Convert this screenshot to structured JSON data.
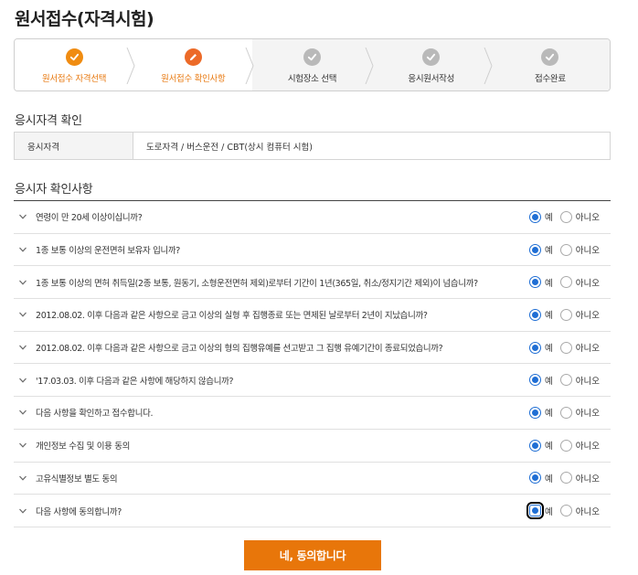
{
  "page": {
    "title": "원서접수(자격시험)"
  },
  "steps": [
    {
      "label": "원서접수 자격선택",
      "status": "done",
      "icon": "check-icon"
    },
    {
      "label": "원서접수 확인사항",
      "status": "current",
      "icon": "pencil-icon"
    },
    {
      "label": "시험장소 선택",
      "status": "todo",
      "icon": "check-icon"
    },
    {
      "label": "응시원서작성",
      "status": "todo",
      "icon": "check-icon"
    },
    {
      "label": "접수완료",
      "status": "todo",
      "icon": "check-icon"
    }
  ],
  "qualification": {
    "section_title": "응시자격 확인",
    "key": "응시자격",
    "value": "도로자격 / 버스운전 / CBT(상시 컴퓨터 시험)"
  },
  "confirm": {
    "section_title": "응시자 확인사항",
    "yes_label": "예",
    "no_label": "아니오",
    "items": [
      {
        "question": "연령이 만 20세 이상이십니까?",
        "selected": "yes"
      },
      {
        "question": "1종 보통 이상의 운전면허 보유자 입니까?",
        "selected": "yes"
      },
      {
        "question": "1종 보통 이상의 면허 취득일(2종 보통, 원동기, 소형운전면허 제외)로부터 기간이 1년(365일, 취소/정지기간 제외)이 넘습니까?",
        "selected": "yes"
      },
      {
        "question": "2012.08.02. 이후 다음과 같은 사항으로 금고 이상의 실형 후 집행종료 또는 면제된 날로부터 2년이 지났습니까?",
        "selected": "yes"
      },
      {
        "question": "2012.08.02. 이후 다음과 같은 사항으로 금고 이상의 형의 집행유예를 선고받고 그 집행 유예기간이 종료되었습니까?",
        "selected": "yes"
      },
      {
        "question": "'17.03.03. 이후 다음과 같은 사항에 해당하지 않습니까?",
        "selected": "yes"
      },
      {
        "question": "다음 사항을 확인하고 접수합니다.",
        "selected": "yes"
      },
      {
        "question": "개인정보 수집 및 이용 동의",
        "selected": "yes"
      },
      {
        "question": "고유식별정보 별도 동의",
        "selected": "yes"
      },
      {
        "question": "다음 사항에 동의합니까?",
        "selected": "yes",
        "focused": true
      }
    ]
  },
  "actions": {
    "agree_label": "네, 동의합니다"
  },
  "colors": {
    "accent": "#e8760a",
    "step_done": "#f08c11",
    "step_current": "#ec6a28",
    "step_todo": "#b9b9b9",
    "radio_on": "#1f6ed4"
  }
}
